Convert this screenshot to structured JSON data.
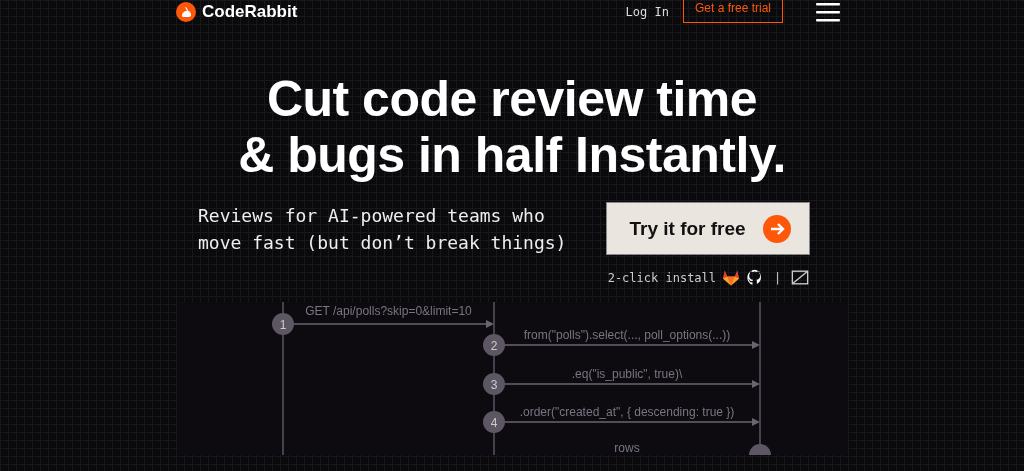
{
  "header": {
    "logo_text": "CodeRabbit",
    "login": "Log In",
    "trial_button": "Get a free trial"
  },
  "hero": {
    "title_lines": [
      "Cut code review time",
      "& bugs in half Instantly."
    ],
    "subtitle_lines": [
      "Reviews for AI-powered teams who",
      "move fast (but don’t break things)"
    ],
    "cta": "Try it for free",
    "install_text": "2-click install",
    "separator": "|"
  },
  "diagram": {
    "steps": [
      {
        "number": "1",
        "label": "GET /api/polls?skip=0&limit=10"
      },
      {
        "number": "2",
        "label": "from(\"polls\").select(..., poll_options(...))"
      },
      {
        "number": "3",
        "label": ".eq(\"is_public\", true)\\"
      },
      {
        "number": "4",
        "label": ".order(\"created_at\", { descending: true })"
      }
    ],
    "return_label": "rows"
  }
}
